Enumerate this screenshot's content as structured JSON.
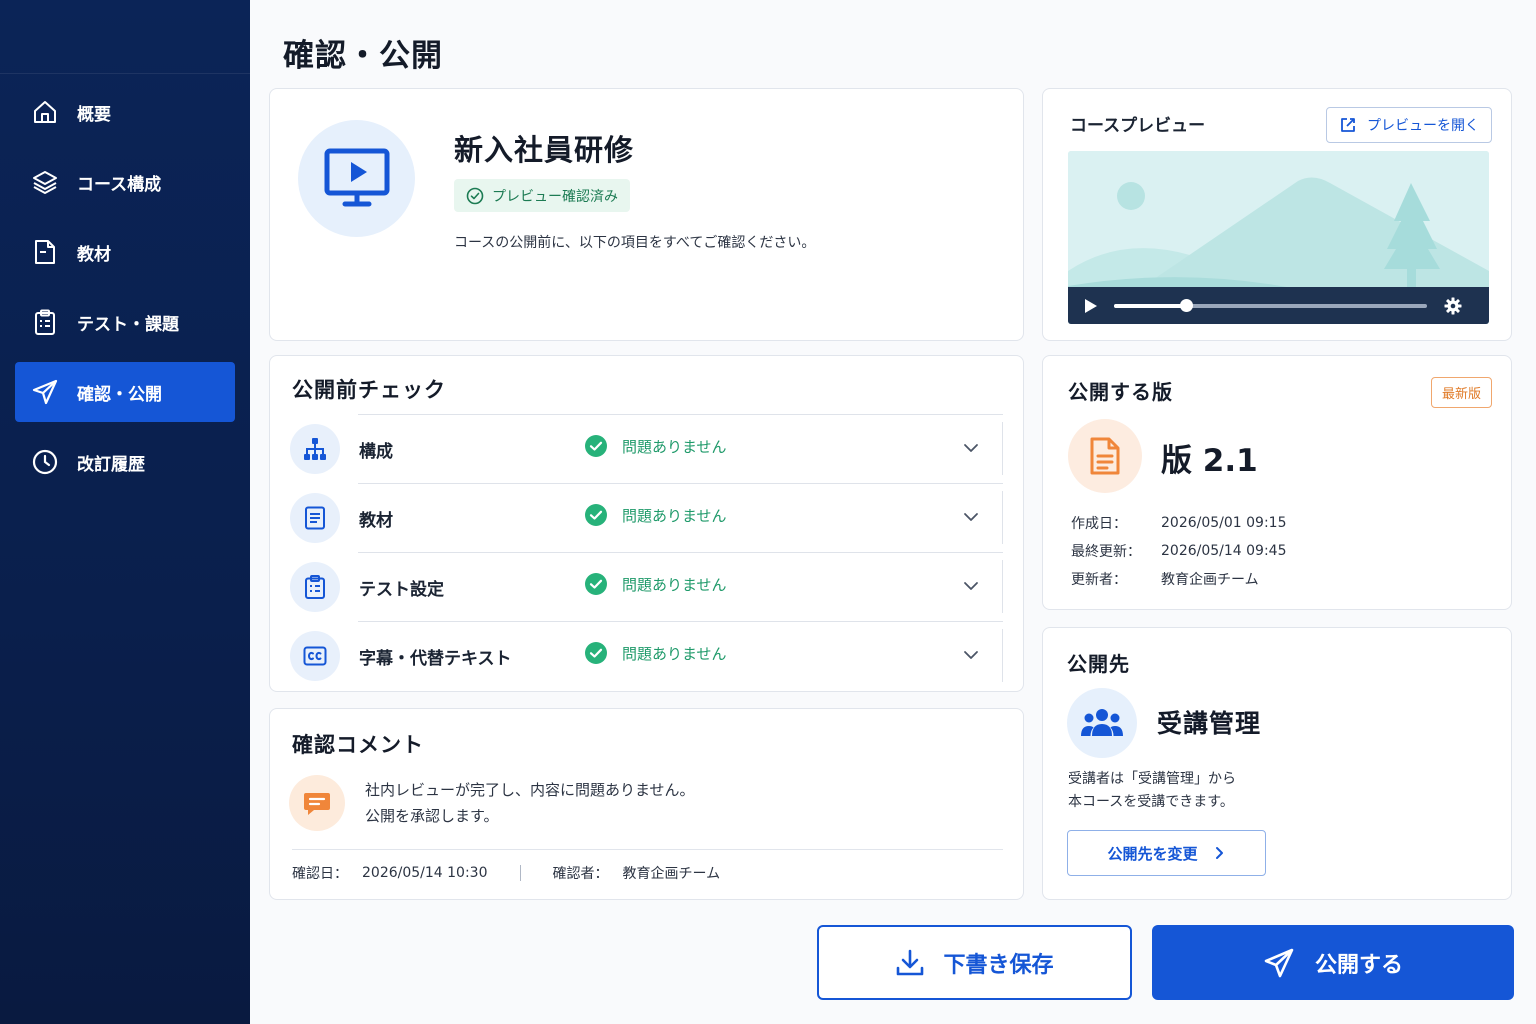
{
  "page": {
    "title": "確認・公開"
  },
  "sidebar": {
    "items": [
      {
        "label": "概要",
        "icon": "home-icon",
        "active": false
      },
      {
        "label": "コース構成",
        "icon": "layers-icon",
        "active": false
      },
      {
        "label": "教材",
        "icon": "document-icon",
        "active": false
      },
      {
        "label": "テスト・課題",
        "icon": "clipboard-icon",
        "active": false
      },
      {
        "label": "確認・公開",
        "icon": "send-icon",
        "active": true
      },
      {
        "label": "改訂履歴",
        "icon": "clock-icon",
        "active": false
      }
    ]
  },
  "course": {
    "title": "新入社員研修",
    "status": "プレビュー確認済み",
    "description": "コースの公開前に、以下の項目をすべてご確認ください。"
  },
  "preview": {
    "label": "コースプレビュー",
    "open_label": "プレビューを開く",
    "progress": 0.23
  },
  "checks": {
    "title": "公開前チェック",
    "items": [
      {
        "label": "構成",
        "status": "問題ありません",
        "icon": "sitemap-icon"
      },
      {
        "label": "教材",
        "status": "問題ありません",
        "icon": "document-lines-icon"
      },
      {
        "label": "テスト設定",
        "status": "問題ありません",
        "icon": "clipboard-icon"
      },
      {
        "label": "字幕・代替テキスト",
        "status": "問題ありません",
        "icon": "caption-icon"
      }
    ]
  },
  "comment": {
    "title": "確認コメント",
    "lines": [
      "社内レビューが完了し、内容に問題ありません。",
      "公開を承認します。"
    ],
    "date_label": "確認日：",
    "date_value": "2026/05/14 10:30",
    "reviewer_label": "確認者：",
    "reviewer_value": "教育企画チーム"
  },
  "version": {
    "title": "公開する版",
    "badge": "最新版",
    "number": "版 2.1",
    "meta": [
      {
        "key": "作成日：",
        "value": "2026/05/01 09:15"
      },
      {
        "key": "最終更新：",
        "value": "2026/05/14 09:45"
      },
      {
        "key": "更新者：",
        "value": "教育企画チーム"
      }
    ]
  },
  "target": {
    "title": "公開先",
    "name": "受講管理",
    "description_lines": [
      "受講者は「受講管理」から",
      "本コースを受講できます。"
    ],
    "change_label": "公開先を変更"
  },
  "actions": {
    "draft_label": "下書き保存",
    "publish_label": "公開する"
  },
  "colors": {
    "sidebar_bg": "#0a1f4c",
    "accent": "#1556d6",
    "success": "#1f9a6a",
    "warning": "#e07b28"
  }
}
